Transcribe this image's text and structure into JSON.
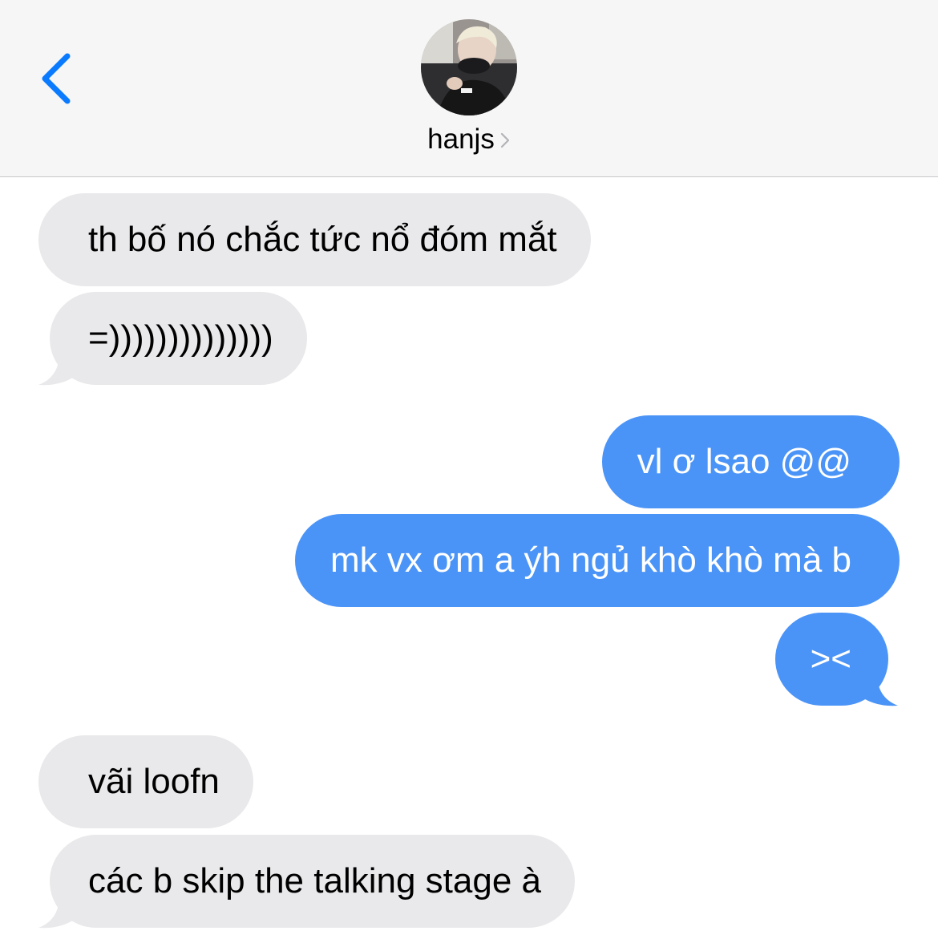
{
  "header": {
    "contact_name": "hanjs",
    "back_icon": "chevron-left-icon",
    "accent_color": "#0a7aff"
  },
  "colors": {
    "incoming_bubble": "#e9e9eb",
    "outgoing_bubble": "#4b94f7"
  },
  "messages": [
    {
      "direction": "incoming",
      "text": "th bố nó chắc tức nổ đóm mắt"
    },
    {
      "direction": "incoming",
      "text": "=))))))))))))))"
    },
    {
      "direction": "outgoing",
      "text": "vl ơ lsao @@"
    },
    {
      "direction": "outgoing",
      "text": "mk vx ơm a ýh ngủ khò khò mà b"
    },
    {
      "direction": "outgoing",
      "text": "><"
    },
    {
      "direction": "incoming",
      "text": "vãi loofn"
    },
    {
      "direction": "incoming",
      "text": "các b skip the talking stage à"
    }
  ]
}
